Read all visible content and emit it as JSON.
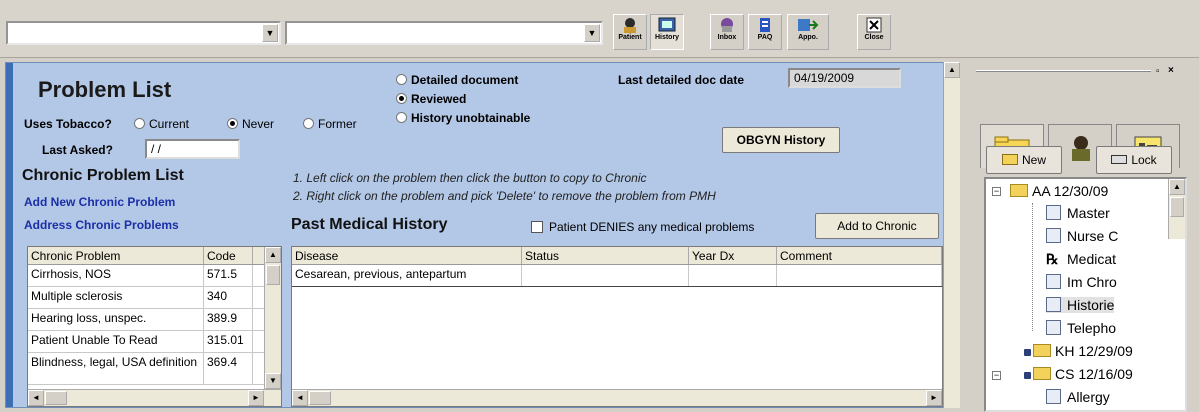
{
  "toolbar": {
    "combo1_value": "",
    "combo2_value": "",
    "buttons": [
      {
        "label": "Patient"
      },
      {
        "label": "History"
      },
      {
        "label": "Inbox"
      },
      {
        "label": "PAQ"
      },
      {
        "label": "Appo."
      },
      {
        "label": "Close"
      }
    ]
  },
  "problem_list": {
    "title": "Problem List",
    "tobacco_label": "Uses Tobacco?",
    "tobacco_options": [
      "Current",
      "Never",
      "Former"
    ],
    "tobacco_selected": "Never",
    "last_asked_label": "Last Asked?",
    "last_asked_value": " / /",
    "doc_options": [
      "Detailed document",
      "Reviewed",
      "History unobtainable"
    ],
    "doc_selected": "Reviewed",
    "last_doc_label": "Last detailed doc date",
    "last_doc_value": "04/19/2009",
    "obgyn_button": "OBGYN History"
  },
  "chronic": {
    "title": "Chronic Problem List",
    "add_link": "Add New Chronic Problem",
    "address_link": "Address Chronic Problems",
    "columns": [
      "Chronic Problem",
      "Code"
    ],
    "rows": [
      {
        "problem": "Cirrhosis, NOS",
        "code": "571.5"
      },
      {
        "problem": "Multiple sclerosis",
        "code": "340"
      },
      {
        "problem": "Hearing loss, unspec.",
        "code": "389.9"
      },
      {
        "problem": "Patient Unable To Read",
        "code": "315.01"
      },
      {
        "problem": "Blindness, legal, USA definition",
        "code": "369.4"
      }
    ]
  },
  "pmh": {
    "instructions": [
      "1. Left click on the problem then click the button to copy to Chronic",
      "2. Right click on the problem and pick 'Delete' to remove the problem from PMH"
    ],
    "title": "Past Medical History",
    "denies_label": "Patient DENIES any medical problems",
    "add_button": "Add to Chronic",
    "columns": [
      "Disease",
      "Status",
      "Year Dx",
      "Comment"
    ],
    "rows": [
      {
        "disease": "Cesarean, previous, antepartum",
        "status": "",
        "year": "",
        "comment": ""
      }
    ]
  },
  "right_panel": {
    "new_button": "New",
    "lock_button": "Lock",
    "tree": [
      {
        "label": "AA 12/30/09",
        "type": "folder"
      },
      {
        "label": "Master",
        "type": "doc"
      },
      {
        "label": "Nurse C",
        "type": "doc"
      },
      {
        "label": "Medicat",
        "type": "rx"
      },
      {
        "label": "Im Chro",
        "type": "doc"
      },
      {
        "label": "Historie",
        "type": "doc"
      },
      {
        "label": "Telepho",
        "type": "doc"
      },
      {
        "label": "KH 12/29/09",
        "type": "locked-folder"
      },
      {
        "label": "CS 12/16/09",
        "type": "locked-folder"
      },
      {
        "label": "Allergy",
        "type": "doc"
      }
    ]
  }
}
